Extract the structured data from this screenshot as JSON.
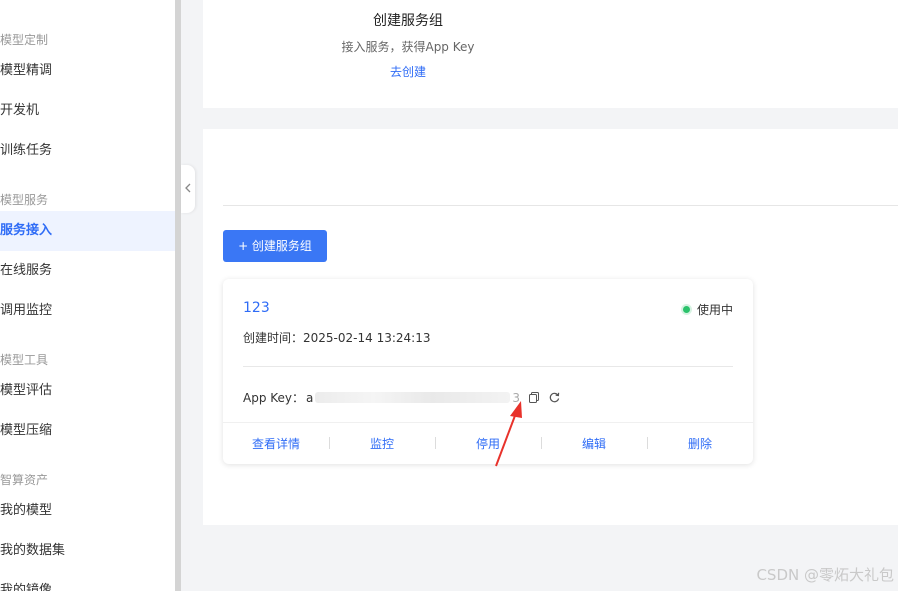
{
  "sidebar": {
    "groups": [
      {
        "title": "模型定制",
        "items": [
          {
            "label": "模型精调"
          },
          {
            "label": "开发机"
          },
          {
            "label": "训练任务"
          }
        ]
      },
      {
        "title": "模型服务",
        "items": [
          {
            "label": "服务接入",
            "active": true
          },
          {
            "label": "在线服务"
          },
          {
            "label": "调用监控"
          }
        ]
      },
      {
        "title": "模型工具",
        "items": [
          {
            "label": "模型评估"
          },
          {
            "label": "模型压缩"
          }
        ]
      },
      {
        "title": "智算资产",
        "items": [
          {
            "label": "我的模型"
          },
          {
            "label": "我的数据集"
          },
          {
            "label": "我的镜像"
          }
        ]
      }
    ],
    "collapse_icon": "chevron-left-icon"
  },
  "top_panel": {
    "title": "创建服务组",
    "subtitle": "接入服务，获得App Key",
    "link": "去创建"
  },
  "main": {
    "create_button": "+ 创建服务组",
    "card": {
      "name": "123",
      "status": "使用中",
      "status_color": "#2bc26b",
      "created_label": "创建时间：",
      "created_value": "2025-02-14 13:24:13",
      "app_key_label": "App Key：",
      "app_key_prefix": "a",
      "app_key_suffix": "3",
      "copy_icon": "copy-icon",
      "refresh_icon": "refresh-icon",
      "actions": [
        "查看详情",
        "监控",
        "停用",
        "编辑",
        "删除"
      ]
    }
  },
  "annotation": {
    "color": "#e8322b",
    "icon": "red-arrow"
  },
  "watermark": "CSDN @零炻大礼包",
  "colors": {
    "accent": "#2f6cf6",
    "button": "#3a77f5"
  }
}
